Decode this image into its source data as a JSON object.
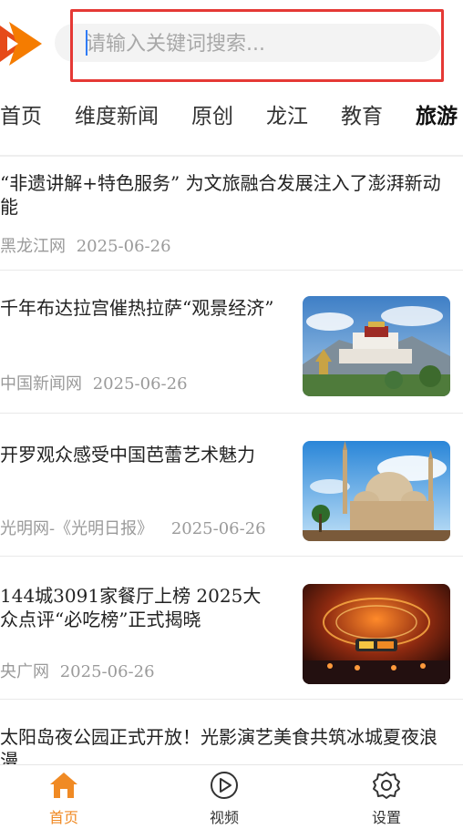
{
  "search": {
    "placeholder": "请输入关键词搜索..."
  },
  "tabs": [
    "首页",
    "维度新闻",
    "原创",
    "龙江",
    "教育",
    "旅游"
  ],
  "articles": [
    {
      "title": "“非遗讲解+特色服务” 为文旅融合发展注入了澎湃新动能",
      "source": "黑龙江网",
      "date": "2025-06-26"
    },
    {
      "title": " 千年布达拉宫催热拉萨“观景经济”",
      "source": "中国新闻网",
      "date": "2025-06-26"
    },
    {
      "title": "开罗观众感受中国芭蕾艺术魅力",
      "source": "光明网-《光明日报》",
      "date": "2025-06-26"
    },
    {
      "title": "144城3091家餐厅上榜 2025大众点评“必吃榜”正式揭晓",
      "source": "央广网",
      "date": "2025-06-26"
    },
    {
      "title": "太阳岛夜公园正式开放！光影演艺美食共筑冰城夏夜浪漫",
      "source": "",
      "date": ""
    }
  ],
  "bottom_nav": [
    {
      "label": "首页",
      "icon": "home-icon",
      "active": true
    },
    {
      "label": "视频",
      "icon": "play-icon",
      "active": false
    },
    {
      "label": "设置",
      "icon": "gear-icon",
      "active": false
    }
  ],
  "colors": {
    "accent": "#f08a24",
    "highlight": "#e53935"
  }
}
